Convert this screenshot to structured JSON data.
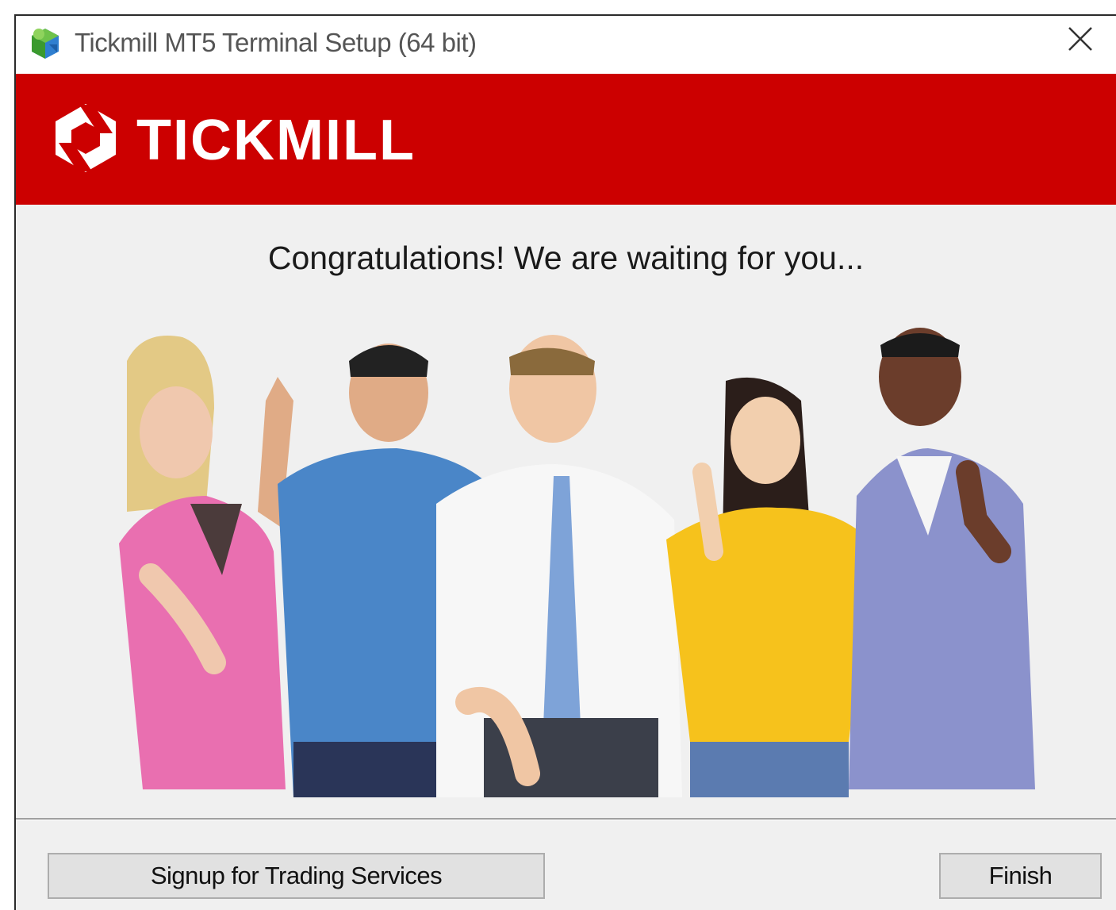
{
  "window": {
    "title": "Tickmill MT5 Terminal Setup (64 bit)",
    "app_icon": "installer-icon",
    "close_icon": "close-icon"
  },
  "banner": {
    "brand_color": "#cc0000",
    "logo_text": "TICKMILL",
    "logo_icon": "tickmill-logo-icon"
  },
  "content": {
    "headline": "Congratulations! We are waiting for you..."
  },
  "footer": {
    "signup_label": "Signup for Trading Services",
    "finish_label": "Finish"
  }
}
